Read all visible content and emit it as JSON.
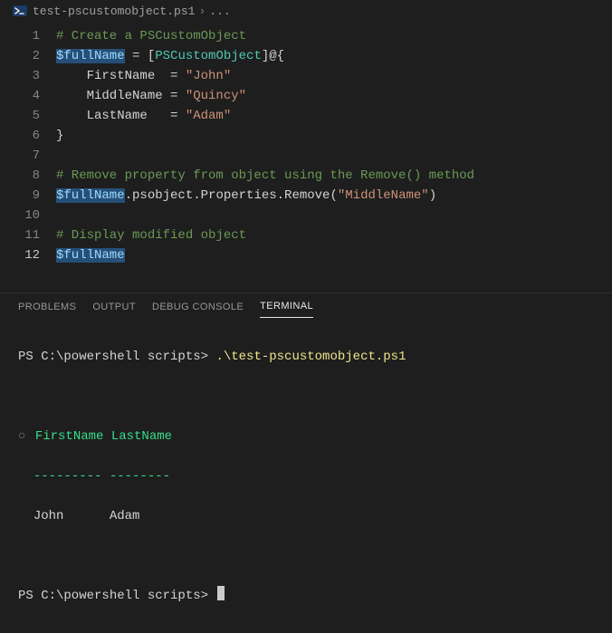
{
  "breadcrumb": {
    "file": "test-pscustomobject.ps1",
    "more": "..."
  },
  "editor": {
    "lines": [
      {
        "n": 1,
        "seg": [
          {
            "t": "# Create a PSCustomObject",
            "c": "tok-comment"
          }
        ]
      },
      {
        "n": 2,
        "seg": [
          {
            "t": "$fullName",
            "c": "tok-var sel"
          },
          {
            "t": " = [",
            "c": "tok-punct"
          },
          {
            "t": "PSCustomObject",
            "c": "tok-type"
          },
          {
            "t": "]@{",
            "c": "tok-punct"
          }
        ]
      },
      {
        "n": 3,
        "seg": [
          {
            "t": "    FirstName  = ",
            "c": "tok-prop"
          },
          {
            "t": "\"John\"",
            "c": "tok-str"
          }
        ]
      },
      {
        "n": 4,
        "seg": [
          {
            "t": "    MiddleName = ",
            "c": "tok-prop"
          },
          {
            "t": "\"Quincy\"",
            "c": "tok-str"
          }
        ]
      },
      {
        "n": 5,
        "seg": [
          {
            "t": "    LastName   = ",
            "c": "tok-prop"
          },
          {
            "t": "\"Adam\"",
            "c": "tok-str"
          }
        ]
      },
      {
        "n": 6,
        "seg": [
          {
            "t": "}",
            "c": "tok-punct"
          }
        ]
      },
      {
        "n": 7,
        "seg": [
          {
            "t": "",
            "c": ""
          }
        ]
      },
      {
        "n": 8,
        "seg": [
          {
            "t": "# Remove property from object using the Remove() method",
            "c": "tok-comment"
          }
        ]
      },
      {
        "n": 9,
        "seg": [
          {
            "t": "$fullName",
            "c": "tok-var sel"
          },
          {
            "t": ".psobject.Properties.Remove(",
            "c": "tok-member"
          },
          {
            "t": "\"MiddleName\"",
            "c": "tok-str"
          },
          {
            "t": ")",
            "c": "tok-member"
          }
        ]
      },
      {
        "n": 10,
        "seg": [
          {
            "t": "",
            "c": ""
          }
        ]
      },
      {
        "n": 11,
        "seg": [
          {
            "t": "# Display modified object",
            "c": "tok-comment"
          }
        ]
      },
      {
        "n": 12,
        "seg": [
          {
            "t": "$fullName",
            "c": "tok-var sel"
          }
        ],
        "active": true
      }
    ]
  },
  "panel": {
    "tabs": {
      "problems": "PROBLEMS",
      "output": "OUTPUT",
      "debug": "DEBUG CONSOLE",
      "terminal": "TERMINAL"
    },
    "active": "terminal"
  },
  "terminal": {
    "prompt1_path": "PS C:\\powershell scripts> ",
    "prompt1_cmd": ".\\test-pscustomobject.ps1",
    "header": "FirstName LastName",
    "dashes": "--------- --------",
    "row": "John      Adam",
    "prompt2_path": "PS C:\\powershell scripts> "
  }
}
